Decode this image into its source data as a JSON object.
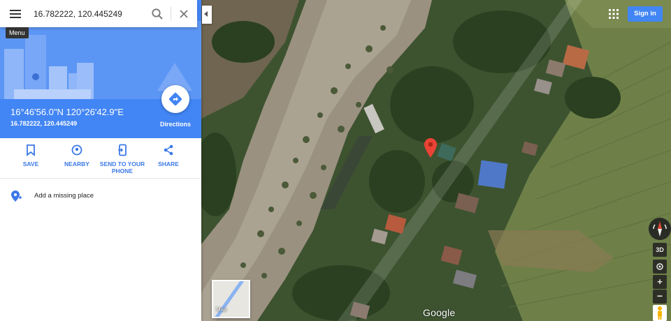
{
  "search": {
    "query": "16.782222, 120.445249",
    "menu_tooltip": "Menu"
  },
  "place": {
    "coords_dms": "16°46'56.0\"N 120°26'42.9\"E",
    "coords_decimal": "16.782222, 120.445249",
    "directions_label": "Directions"
  },
  "actions": [
    {
      "label": "SAVE",
      "icon": "bookmark-icon"
    },
    {
      "label": "NEARBY",
      "icon": "nearby-icon"
    },
    {
      "label": "SEND TO YOUR PHONE",
      "icon": "send-to-phone-icon"
    },
    {
      "label": "SHARE",
      "icon": "share-icon"
    }
  ],
  "add_missing_place": "Add a missing place",
  "header": {
    "signin_label": "Sign in"
  },
  "map": {
    "layer_toggle_label": "Map",
    "logo": "Google",
    "btn_3d": "3D",
    "zoom_in": "+",
    "zoom_out": "−"
  },
  "colors": {
    "accent": "#4285f4",
    "action_text": "#3b78e7",
    "pin": "#ea4335"
  }
}
